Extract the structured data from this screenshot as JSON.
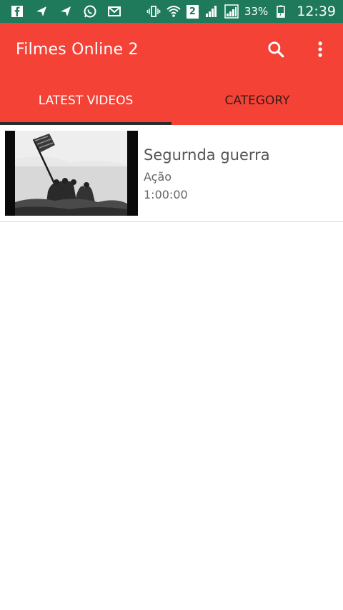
{
  "status_bar": {
    "icons": [
      "facebook-icon",
      "send-icon",
      "send-icon",
      "whatsapp-icon",
      "mail-icon",
      "vibrate-icon",
      "wifi-icon",
      "signal-icon",
      "signal-icon"
    ],
    "sim_label": "2",
    "battery": "33%",
    "time": "12:39",
    "color": "#1f7a5c"
  },
  "app_bar": {
    "title": "Filmes Online 2",
    "color": "#f44336",
    "actions": [
      "search-icon",
      "more-vert-icon"
    ]
  },
  "tabs": [
    {
      "label": "LATEST VIDEOS",
      "selected": true
    },
    {
      "label": "CATEGORY",
      "selected": false
    }
  ],
  "videos": [
    {
      "title": "Segurnda guerra",
      "category": "Ação",
      "duration": "1:00:00",
      "thumbnail": "flag-raising-photo"
    }
  ]
}
